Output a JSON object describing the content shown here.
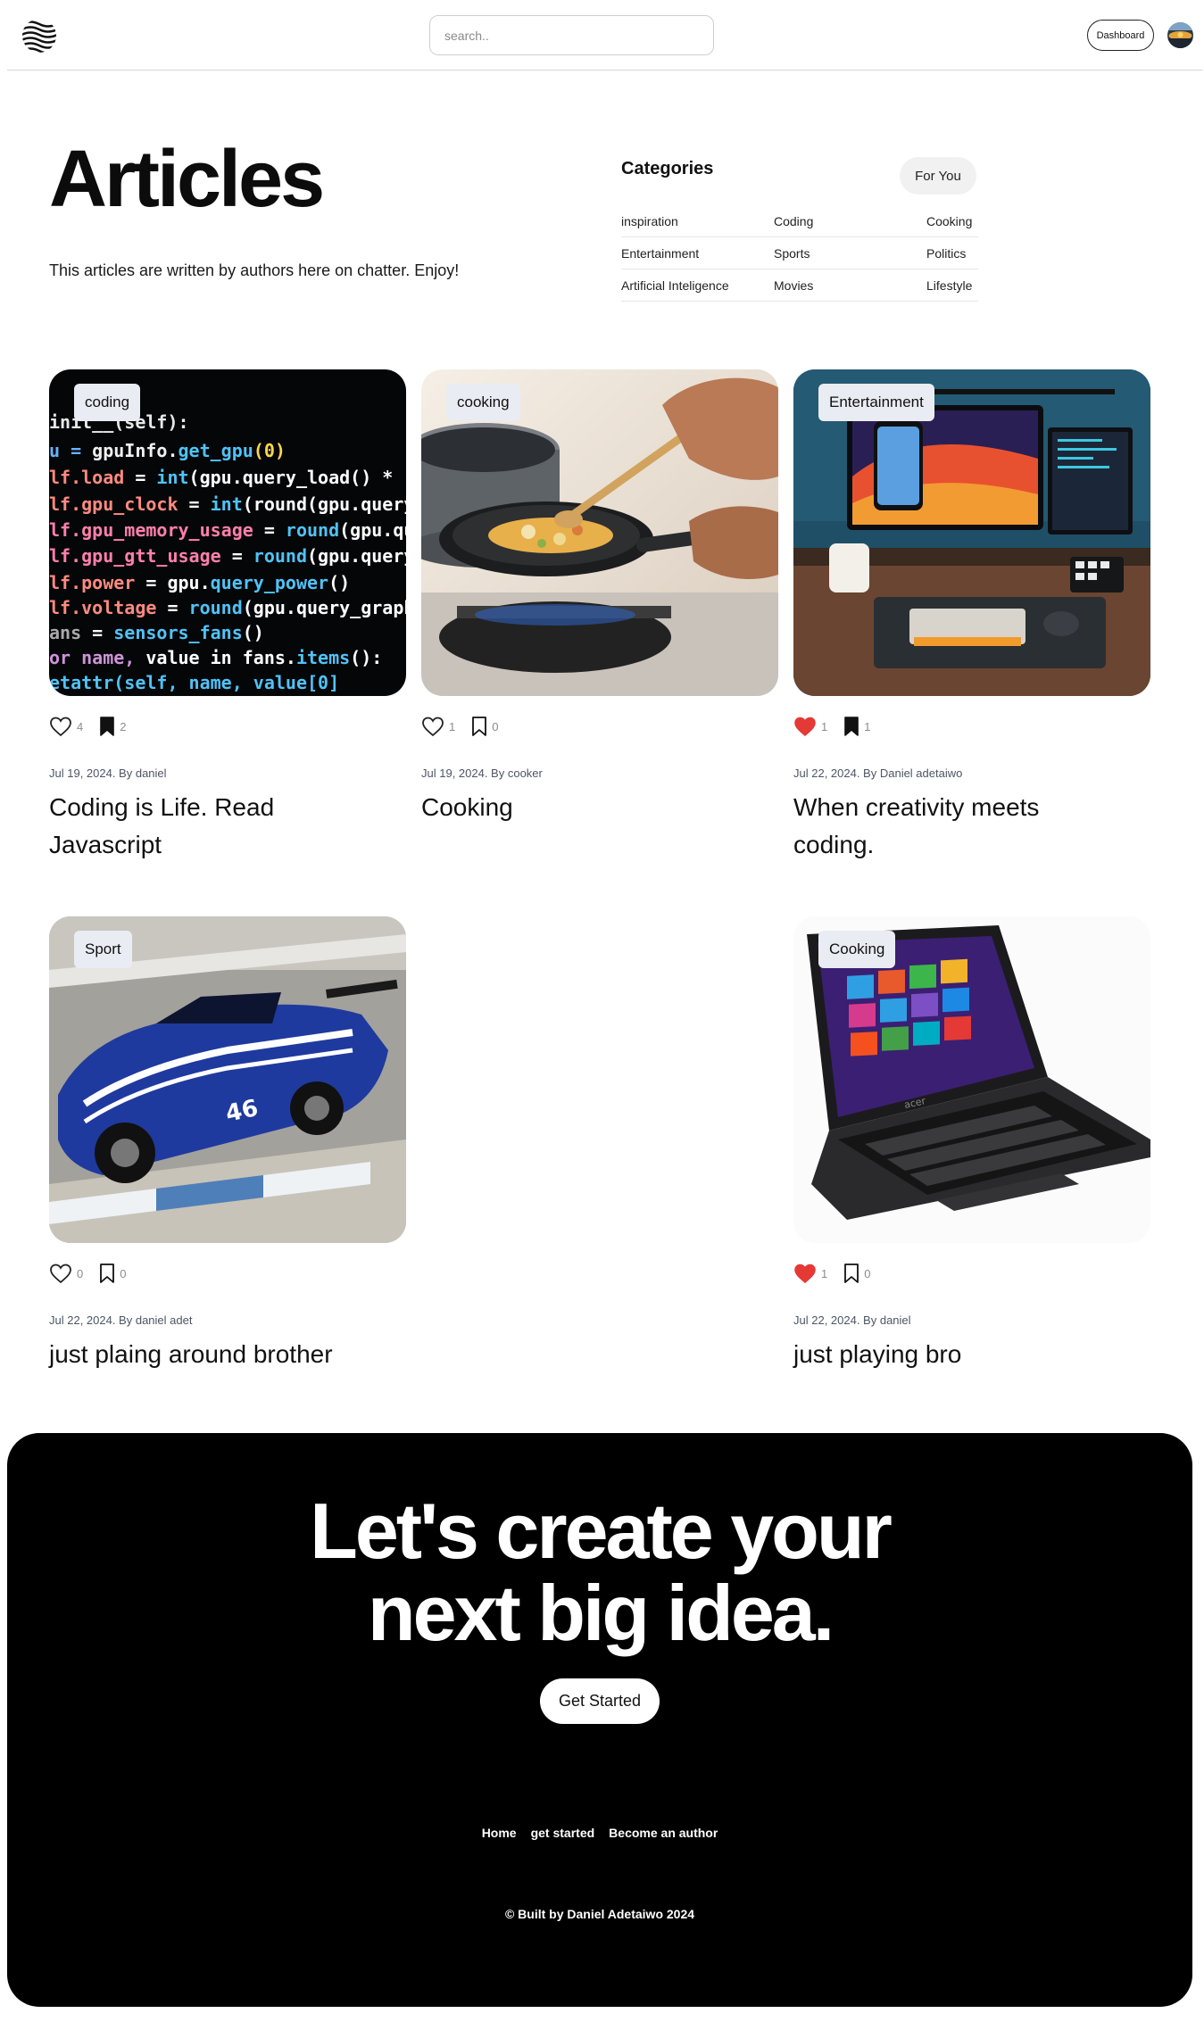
{
  "header": {
    "search_placeholder": "search..",
    "dashboard_label": "Dashboard"
  },
  "hero": {
    "title": "Articles",
    "subtitle": "This articles are written by authors here on chatter. Enjoy!"
  },
  "categories": {
    "heading": "Categories",
    "for_you_label": "For You",
    "items": [
      "inspiration",
      "Coding",
      "Cooking",
      "Entertainment",
      "Sports",
      "Politics",
      "Artificial Inteligence",
      "Movies",
      "Lifestyle"
    ]
  },
  "articles": [
    {
      "tag": "coding",
      "likes": "4",
      "bookmarks": "2",
      "liked": false,
      "bookmarked": true,
      "meta": "Jul 19, 2024. By daniel",
      "title": "Coding is Life. Read Javascript",
      "image_icon": "code-screen-image"
    },
    {
      "tag": "cooking",
      "likes": "1",
      "bookmarks": "0",
      "liked": false,
      "bookmarked": false,
      "meta": "Jul 19, 2024. By cooker",
      "title": "Cooking",
      "image_icon": "cooking-pan-image"
    },
    {
      "tag": "Entertainment",
      "likes": "1",
      "bookmarks": "1",
      "liked": true,
      "bookmarked": true,
      "meta": "Jul 22, 2024. By Daniel adetaiwo",
      "title": "When creativity meets coding.",
      "image_icon": "desk-setup-image"
    },
    {
      "tag": "Sport",
      "likes": "0",
      "bookmarks": "0",
      "liked": false,
      "bookmarked": false,
      "meta": "Jul 22, 2024. By daniel adet",
      "title": "just plaing around brother",
      "image_icon": "race-car-image"
    },
    {
      "tag": "Cooking",
      "likes": "1",
      "bookmarks": "0",
      "liked": true,
      "bookmarked": false,
      "meta": "Jul 22, 2024. By daniel",
      "title": "just playing bro",
      "image_icon": "laptop-image"
    }
  ],
  "footer": {
    "cta_line1": "Let's create your",
    "cta_line2": "next big idea.",
    "get_started_label": "Get Started",
    "nav": [
      "Home",
      "get started",
      "Become an author"
    ],
    "copyright": "© Built by Daniel Adetaiwo 2024"
  },
  "colors": {
    "accent_black": "#000000",
    "heart_red": "#e53935",
    "tag_bg": "#e9ecf2",
    "meta_text": "#4d5565"
  }
}
